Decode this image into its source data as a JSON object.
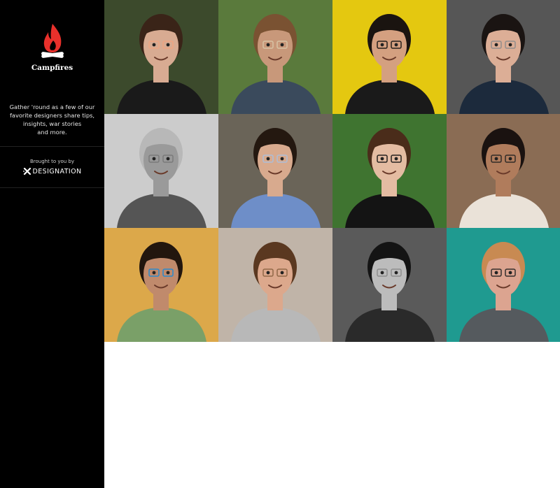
{
  "sidebar": {
    "brand_name": "Campfires",
    "tagline_lines": [
      "Gather 'round as a few of our",
      "favorite designers share tips,",
      "insights, war stories",
      "and more."
    ],
    "sponsor": {
      "label": "Brought to you by",
      "name": "DESIGNATION"
    }
  },
  "colors": {
    "flame": "#e8302b",
    "sidebar_bg": "#000000",
    "page_bg": "#ffffff"
  },
  "speakers": [
    {
      "bg": "#3c4a2c",
      "skin": "#d8ab92",
      "hair": "#3a2418",
      "shirt": "#1a1a1a",
      "accent": "#f2a380",
      "icon": "portrait-woman-flower"
    },
    {
      "bg": "#5a7a3c",
      "skin": "#c8987a",
      "hair": "#7a5232",
      "shirt": "#3a4a5c",
      "accent": "#d8c8a8",
      "icon": "portrait-man-cap-beard"
    },
    {
      "bg": "#e4c810",
      "skin": "#d4a080",
      "hair": "#1a1410",
      "shirt": "#1a1a1a",
      "accent": "#111111",
      "icon": "portrait-man-glasses"
    },
    {
      "bg": "#565656",
      "skin": "#dcae96",
      "hair": "#1a1412",
      "shirt": "#1c2a3c",
      "accent": "#8a8a8a",
      "icon": "portrait-man-blazer"
    },
    {
      "bg": "#cccccc",
      "skin": "#9a9a9a",
      "hair": "#b8b8b8",
      "shirt": "#555555",
      "accent": "#777777",
      "icon": "portrait-man-bw"
    },
    {
      "bg": "#6a6458",
      "skin": "#d8aa8e",
      "hair": "#241810",
      "shirt": "#6e8ec8",
      "accent": "#a8c0e0",
      "icon": "portrait-man-plaid"
    },
    {
      "bg": "#3f7430",
      "skin": "#e4bca2",
      "hair": "#4a2c1a",
      "shirt": "#141414",
      "accent": "#111111",
      "icon": "portrait-woman-glasses"
    },
    {
      "bg": "#8a6c54",
      "skin": "#b07c5c",
      "hair": "#1a1210",
      "shirt": "#eae2d8",
      "accent": "#222222",
      "icon": "portrait-man-sunglasses"
    },
    {
      "bg": "#dca84a",
      "skin": "#c08a6c",
      "hair": "#22160e",
      "shirt": "#7aa068",
      "accent": "#1a8ad8",
      "icon": "portrait-man-couch"
    },
    {
      "bg": "#c0b4a8",
      "skin": "#dca88c",
      "hair": "#5a3820",
      "shirt": "#b8b8b8",
      "accent": "#8a6040",
      "icon": "portrait-man-smiling"
    },
    {
      "bg": "#5a5a5a",
      "skin": "#bcbcbc",
      "hair": "#141414",
      "shirt": "#2a2a2a",
      "accent": "#888888",
      "icon": "portrait-woman-bw"
    },
    {
      "bg": "#1f9a90",
      "skin": "#dca490",
      "hair": "#c88a52",
      "shirt": "#555a5e",
      "accent": "#222222",
      "icon": "portrait-man-teal"
    }
  ]
}
